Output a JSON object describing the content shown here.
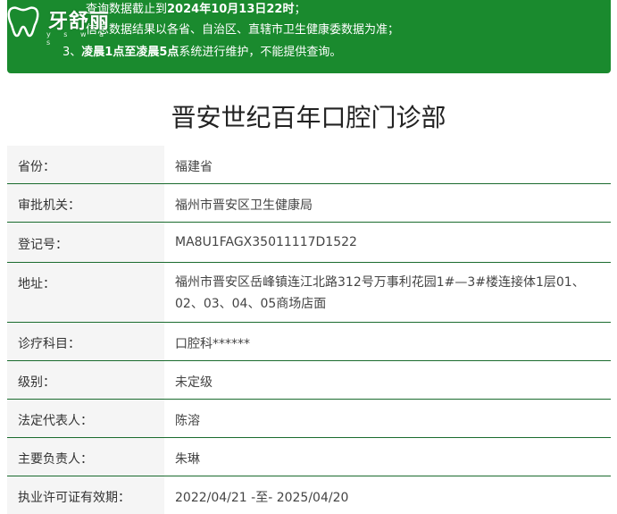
{
  "notice": {
    "line1_prefix": "查询数据截止到",
    "line1_bold": "2024年10月13日22时",
    "line1_suffix": "；",
    "line2": "信息数据结果以各省、自治区、直辖市卫生健康委数据为准；",
    "line3_prefix": "3、",
    "line3_bold": "凌晨1点至凌晨5点",
    "line3_suffix": "系统进行维护，不能提供查询。",
    "background_color": "#1a8a2e"
  },
  "logo": {
    "brand": "牙舒丽",
    "sub": "y  s  w  a  s"
  },
  "page_title": "晋安世纪百年口腔门诊部",
  "info": {
    "rows": [
      {
        "label": "省份：",
        "value": "福建省"
      },
      {
        "label": "审批机关：",
        "value": "福州市晋安区卫生健康局"
      },
      {
        "label": "登记号：",
        "value": "MA8U1FAGX35011117D1522"
      },
      {
        "label": "地址：",
        "value": "福州市晋安区岳峰镇连江北路312号万事利花园1#—3#楼连接体1层01、02、03、04、05商场店面"
      },
      {
        "label": "诊疗科目：",
        "value": "口腔科******"
      },
      {
        "label": "级别：",
        "value": "未定级"
      },
      {
        "label": "法定代表人：",
        "value": "陈溶"
      },
      {
        "label": "主要负责人：",
        "value": "朱琳"
      },
      {
        "label": "执业许可证有效期：",
        "value": "2022/04/21 -至- 2025/04/20"
      }
    ],
    "divider_color": "#1a6b2e"
  }
}
